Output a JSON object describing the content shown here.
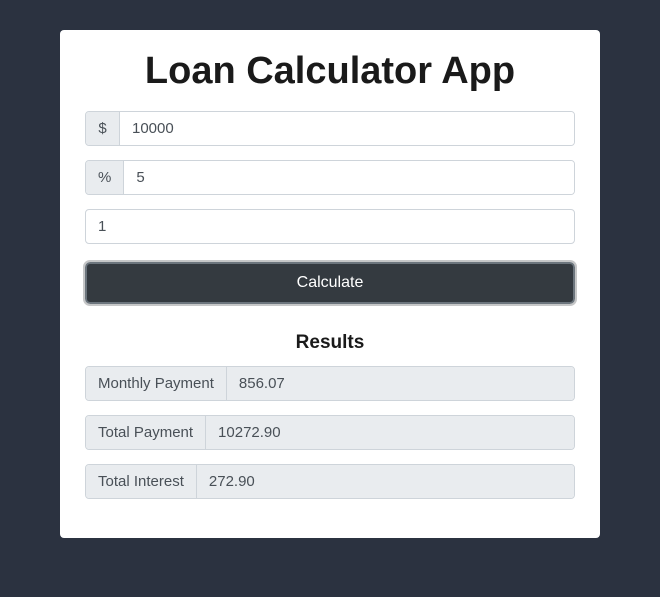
{
  "title": "Loan Calculator App",
  "inputs": {
    "amount_prefix": "$",
    "amount_value": "10000",
    "rate_prefix": "%",
    "rate_value": "5",
    "years_value": "1"
  },
  "button": {
    "calculate_label": "Calculate"
  },
  "results": {
    "heading": "Results",
    "monthly_payment_label": "Monthly Payment",
    "monthly_payment_value": "856.07",
    "total_payment_label": "Total Payment",
    "total_payment_value": "10272.90",
    "total_interest_label": "Total Interest",
    "total_interest_value": "272.90"
  }
}
